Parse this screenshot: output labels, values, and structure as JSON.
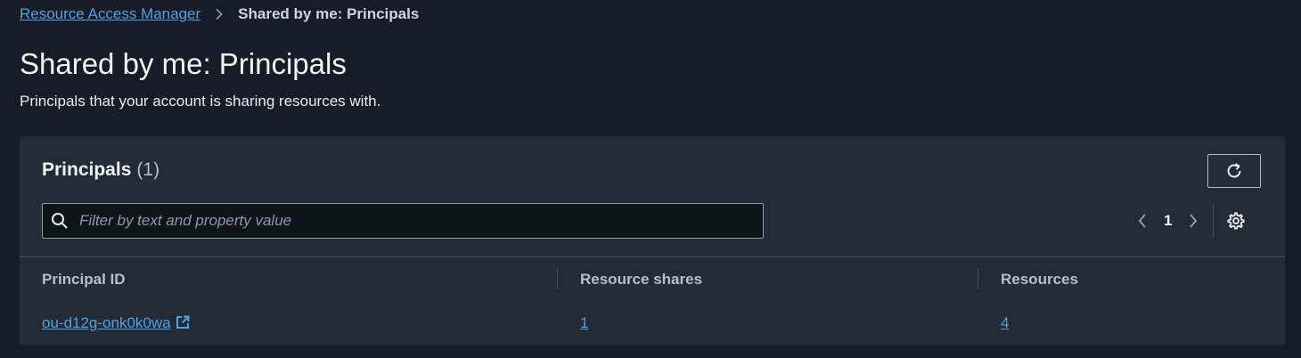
{
  "breadcrumb": {
    "parent": "Resource Access Manager",
    "current": "Shared by me: Principals"
  },
  "page": {
    "title": "Shared by me: Principals",
    "description": "Principals that your account is sharing resources with."
  },
  "panel": {
    "title": "Principals",
    "count": "(1)",
    "refresh_icon": "refresh-icon",
    "search": {
      "placeholder": "Filter by text and property value",
      "value": "",
      "icon": "search-icon"
    },
    "pagination": {
      "current_page": "1",
      "prev_icon": "chevron-left-icon",
      "next_icon": "chevron-right-icon",
      "settings_icon": "gear-icon"
    }
  },
  "table": {
    "columns": [
      "Principal ID",
      "Resource shares",
      "Resources"
    ],
    "rows": [
      {
        "principal_id": "ou-d12g-onk0k0wa",
        "resource_shares": "1",
        "resources": "4",
        "external_icon": "external-link-icon"
      }
    ]
  },
  "colors": {
    "background": "#161d26",
    "panel": "#232b36",
    "link": "#539fe5",
    "border": "#414d5c"
  }
}
